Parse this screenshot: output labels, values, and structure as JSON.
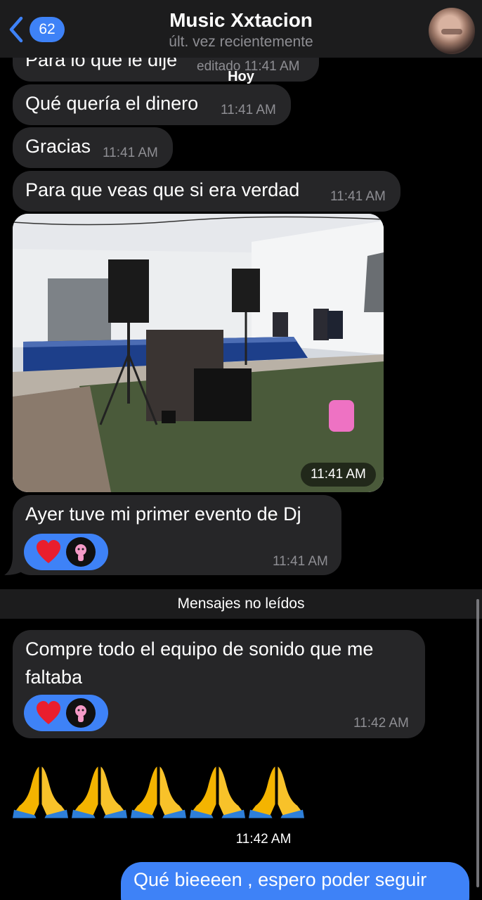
{
  "header": {
    "unread_count": "62",
    "title": "Music Xxtacion",
    "subtitle": "últ. vez recientemente"
  },
  "date_label": "Hoy",
  "messages": [
    {
      "text": "Para lo que le dije",
      "meta": "editado 11:41 AM"
    },
    {
      "text": "Qué quería el dinero",
      "meta": "11:41 AM"
    },
    {
      "text": "Gracias",
      "meta": "11:41 AM"
    },
    {
      "text": "Para que veas que si era verdad",
      "meta": "11:41 AM"
    },
    {
      "photo_time": "11:41 AM"
    },
    {
      "text": "Ayer tuve mi primer evento de Dj",
      "meta": "11:41 AM"
    }
  ],
  "unread_divider": "Mensajes no leídos",
  "unread_messages": [
    {
      "text_line1": "Compre todo el equipo de sonido que me",
      "text_line2": "faltaba",
      "meta": "11:42 AM"
    },
    {
      "emoji": "🙏🙏🙏🙏🙏",
      "meta": "11:42 AM"
    }
  ],
  "outgoing": {
    "text": "Qué bieeeen , espero poder seguir"
  },
  "colors": {
    "accent": "#3e82f7",
    "bubble_in": "#262628",
    "header_bg": "#1c1c1d",
    "meta_text": "#8e8e93"
  },
  "icons": [
    "chevron-left-icon",
    "heart-icon",
    "pink-panther-avatar",
    "folded-hands-emoji"
  ]
}
